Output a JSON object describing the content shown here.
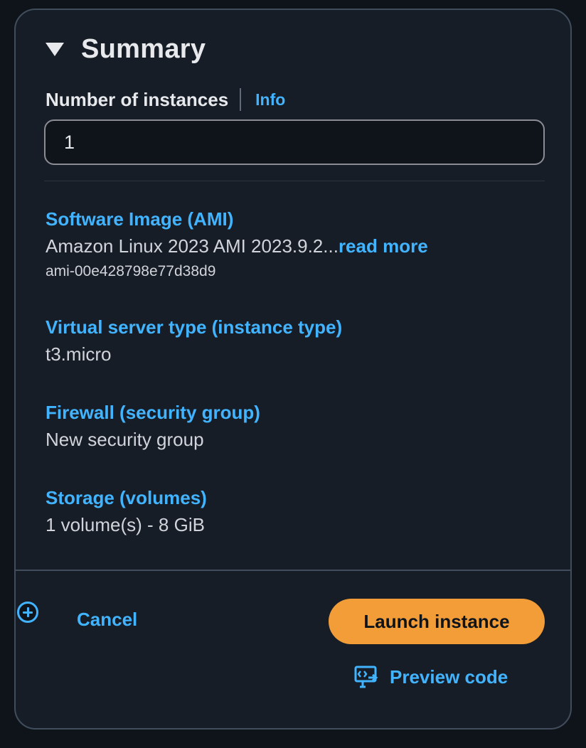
{
  "summary": {
    "title": "Summary",
    "instances": {
      "label": "Number of instances",
      "info_label": "Info",
      "value": "1"
    },
    "ami": {
      "label": "Software Image (AMI)",
      "value": "Amazon Linux 2023 AMI 2023.9.2...",
      "read_more": "read more",
      "id": "ami-00e428798e77d38d9"
    },
    "instance_type": {
      "label": "Virtual server type (instance type)",
      "value": "t3.micro"
    },
    "firewall": {
      "label": "Firewall (security group)",
      "value": "New security group"
    },
    "storage": {
      "label": "Storage (volumes)",
      "value": "1 volume(s) - 8 GiB"
    }
  },
  "footer": {
    "cancel_label": "Cancel",
    "launch_label": "Launch instance",
    "preview_label": "Preview code"
  },
  "icons": {
    "collapse": "caret-down-icon",
    "expand": "plus-circle-icon",
    "preview": "code-preview-icon"
  },
  "colors": {
    "background": "#0f141a",
    "panel": "#161d26",
    "border": "#414d5c",
    "link": "#42b4ff",
    "primary_button": "#f29d38",
    "text": "#e7e9ec"
  }
}
